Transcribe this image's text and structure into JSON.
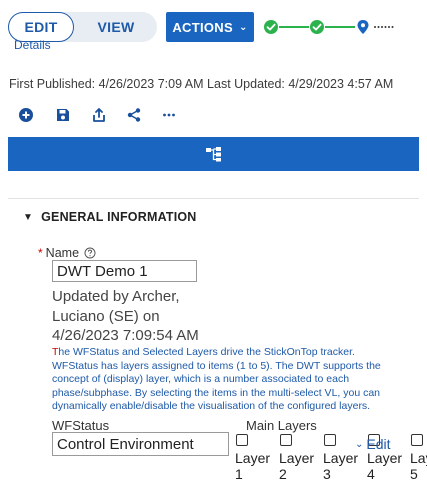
{
  "header": {
    "edit_label": "EDIT",
    "view_label": "VIEW",
    "actions_label": "ACTIONS",
    "details_link": "Details",
    "stepper": [
      "completed",
      "completed",
      "current"
    ]
  },
  "meta": {
    "text": "First Published: 4/26/2023 7:09 AM Last Updated: 4/29/2023 4:57 AM"
  },
  "toolbar": {
    "icons": [
      "add-icon",
      "save-icon",
      "export-icon",
      "share-icon",
      "more-icon"
    ]
  },
  "banner": {
    "icon": "hierarchy-icon"
  },
  "section": {
    "title": "GENERAL INFORMATION"
  },
  "form": {
    "name_label": "Name",
    "name_value": "DWT Demo 1",
    "updated_text": "Updated by Archer, Luciano (SE) on 4/26/2023 7:09:54 AM",
    "description_first": "T",
    "description_rest": "he WFStatus and Selected Layers drive the StickOnTop tracker. WFStatus has layers assigned to items (1 to 5). The DWT supports the concept of (display) layer, which is a number associated to each phase/subphase. By selecting the items in the multi-select VL, you can dynamically enable/disable the visualisation of the configured layers.",
    "wfstatus_label": "WFStatus",
    "wfstatus_value": "Control Environment",
    "main_layers_label": "Main Layers",
    "edit_link": "Edit",
    "layers": [
      {
        "word": "Layer",
        "num": "1"
      },
      {
        "word": "Layer",
        "num": "2"
      },
      {
        "word": "Layer",
        "num": "3"
      },
      {
        "word": "Layer",
        "num": "4"
      },
      {
        "word": "Lay",
        "num": "5"
      }
    ]
  },
  "colors": {
    "primary": "#1a65c0",
    "link": "#1e5aa8",
    "success": "#2bb24c",
    "required": "#cc0000"
  }
}
